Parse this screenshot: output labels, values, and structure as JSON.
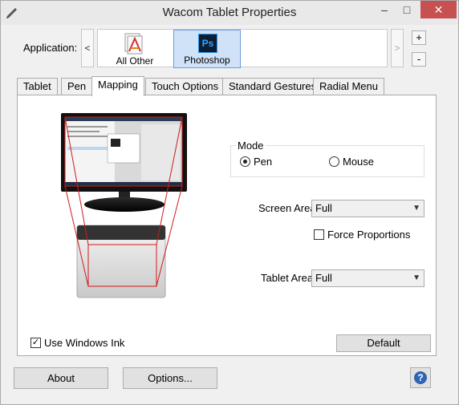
{
  "window": {
    "title": "Wacom Tablet Properties",
    "min_glyph": "–",
    "max_glyph": "□",
    "close_glyph": "✕"
  },
  "application": {
    "label": "Application:",
    "prev_glyph": "<",
    "next_glyph": ">",
    "items": [
      {
        "label": "All Other",
        "icon": "all-other-icon"
      },
      {
        "label": "Photoshop",
        "icon": "photoshop-icon",
        "icon_text": "Ps",
        "selected": true
      }
    ],
    "add_glyph": "+",
    "remove_glyph": "-"
  },
  "tabs": [
    {
      "label": "Tablet"
    },
    {
      "label": "Pen"
    },
    {
      "label": "Mapping",
      "active": true
    },
    {
      "label": "Touch Options"
    },
    {
      "label": "Standard Gestures"
    },
    {
      "label": "Radial Menu"
    }
  ],
  "mapping": {
    "mode": {
      "label": "Mode",
      "pen_label": "Pen",
      "mouse_label": "Mouse",
      "selected": "Pen"
    },
    "screen_area": {
      "label": "Screen Area:",
      "value": "Full"
    },
    "force_proportions": {
      "label": "Force Proportions",
      "checked": false
    },
    "tablet_area": {
      "label": "Tablet Area:",
      "value": "Full"
    },
    "use_windows_ink": {
      "label": "Use Windows Ink",
      "checked": true,
      "check_glyph": "✓"
    },
    "default_label": "Default"
  },
  "footer": {
    "about_label": "About",
    "options_label": "Options...",
    "help_glyph": "?"
  },
  "colors": {
    "mapping_lines": "#d11a1a",
    "selected_app_bg": "#cfe2f8",
    "close_button": "#c75050"
  }
}
